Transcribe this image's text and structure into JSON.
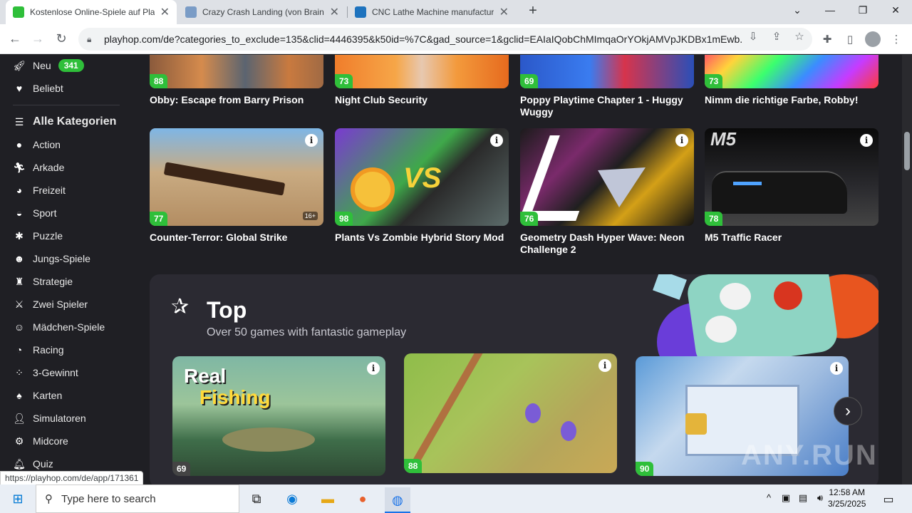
{
  "browser": {
    "tabs": [
      {
        "title": "Kostenlose Online-Spiele auf Playhop",
        "active": true
      },
      {
        "title": "Crazy Crash Landing (von Brainium",
        "active": false
      },
      {
        "title": "CNC Lathe Machine manufacturer",
        "active": false
      }
    ],
    "new_tab": "+",
    "url": "playhop.com/de?categories_to_exclude=135&clid=4446395&k50id=%7C&gad_source=1&gclid=EAIaIQobChMImqaOrYOkjAMVpJKDBx1mEwb..."
  },
  "sidebar": {
    "new_label": "Neu",
    "new_count": "341",
    "popular_label": "Beliebt",
    "all_categories": "Alle Kategorien",
    "categories": [
      "Action",
      "Arkade",
      "Freizeit",
      "Sport",
      "Puzzle",
      "Jungs-Spiele",
      "Strategie",
      "Zwei Spieler",
      "Mädchen-Spiele",
      "Racing",
      "3-Gewinnt",
      "Karten",
      "Simulatoren",
      "Midcore",
      "Quiz"
    ]
  },
  "games_row1": [
    {
      "title": "Obby: Escape from Barry Prison",
      "rating": "88"
    },
    {
      "title": "Night Club Security",
      "rating": "73"
    },
    {
      "title": "Poppy Playtime Chapter 1 - Huggy Wuggy",
      "rating": "69"
    },
    {
      "title": "Nimm die richtige Farbe, Robby!",
      "rating": "73"
    }
  ],
  "games_row2": [
    {
      "title": "Counter-Terror: Global Strike",
      "rating": "77",
      "age": "16+"
    },
    {
      "title": "Plants Vs Zombie Hybrid Story Mod",
      "rating": "98",
      "vs": "VS"
    },
    {
      "title": "Geometry Dash Hyper Wave: Neon Challenge 2",
      "rating": "76"
    },
    {
      "title": "M5 Traffic Racer",
      "rating": "78",
      "badge": "M5"
    }
  ],
  "top": {
    "title": "Top",
    "subtitle": "Over 50 games with fantastic gameplay",
    "cards": [
      {
        "rating": "69",
        "line1": "Real",
        "line2": "Fishing"
      },
      {
        "rating": "88"
      },
      {
        "rating": "90"
      }
    ]
  },
  "status_url": "https://playhop.com/de/app/171361",
  "watermark": "ANY.RUN",
  "taskbar": {
    "search_placeholder": "Type here to search",
    "time": "12:58 AM",
    "date": "3/25/2025"
  },
  "colors": {
    "accent_green": "#2fbf3a",
    "page_bg": "#1f1f24"
  }
}
